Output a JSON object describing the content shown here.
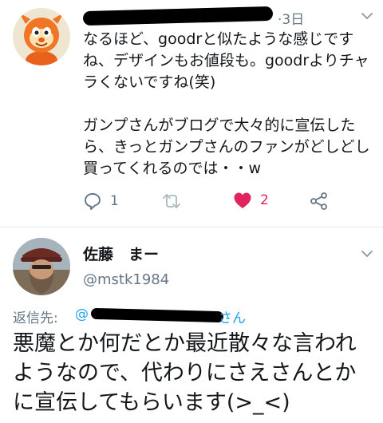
{
  "tweet1": {
    "timestamp": "3日",
    "body": "なるほど、goodrと似たような感じですね、デザインもお値段も。goodrよりチャラくないですね(笑)\n\nガンプさんがブログで大々的に宣伝したら、きっとガンプさんのファンがどしどし買ってくれるのでは・・w",
    "reply_count": "1",
    "like_count": "2",
    "colors": {
      "like": "#e0245e",
      "muted": "#657786",
      "link": "#1da1f2"
    }
  },
  "tweet2": {
    "display_name": "佐藤　まー",
    "handle": "@mstk1984",
    "reply_label": "返信先:",
    "reply_handle_start": "@",
    "reply_handle_end": "さん",
    "body": "悪魔とか何だとか最近散々な言われようなので、代わりにさえさんとかに宣伝してもらいます(>_<)"
  }
}
